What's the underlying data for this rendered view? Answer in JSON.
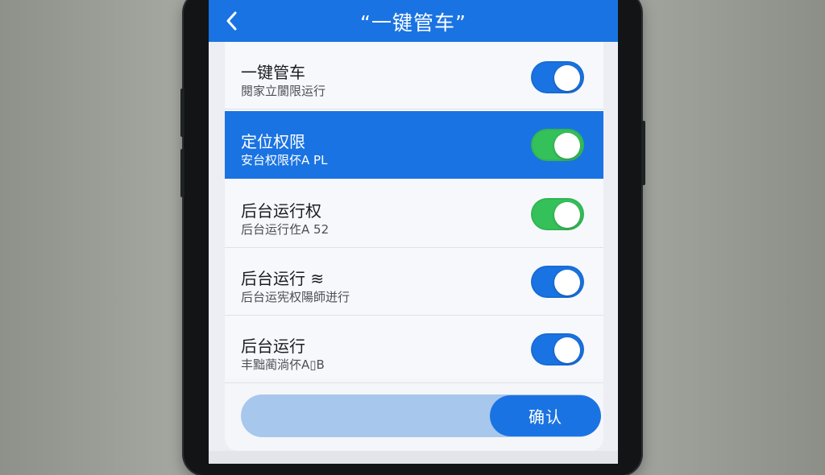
{
  "header": {
    "title": "“一键管车”",
    "back_icon": "chevron-left-icon"
  },
  "settings": [
    {
      "label": "一键管车",
      "sublabel": "閱家立閬限运行",
      "toggle_on": true,
      "toggle_color": "#1a73e2",
      "selected": false
    },
    {
      "label": "定位权限",
      "sublabel": "安台权限伓A PL",
      "toggle_on": true,
      "toggle_color": "#35c159",
      "selected": true
    },
    {
      "label": "后台运行权",
      "sublabel": "后台运行㑅A 52",
      "toggle_on": true,
      "toggle_color": "#35c159",
      "selected": false
    },
    {
      "label": "后台运行 ≋",
      "sublabel": "后台运宪权陽師迸行",
      "toggle_on": true,
      "toggle_color": "#1a73e2",
      "selected": false
    },
    {
      "label": "后台运行",
      "sublabel": "丰黜蔺淌伓A▯B",
      "toggle_on": true,
      "toggle_color": "#1a73e2",
      "selected": false
    }
  ],
  "footer": {
    "confirm_label": "确认"
  },
  "colors": {
    "accent": "#1a73e2",
    "toggle_green": "#35c159",
    "progress_track": "#a7c7ec"
  }
}
